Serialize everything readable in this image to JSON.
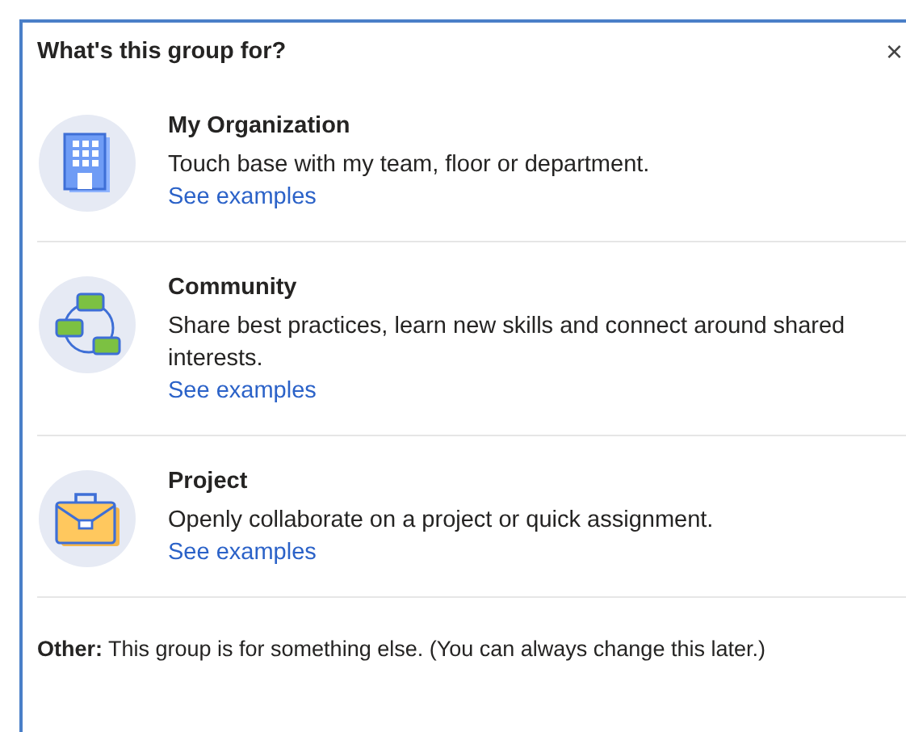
{
  "dialog": {
    "title": "What's this group for?",
    "close": "×"
  },
  "options": [
    {
      "kind": "building",
      "title": "My Organization",
      "description": "Touch base with my team, floor or department.",
      "link": "See examples"
    },
    {
      "kind": "network",
      "title": "Community",
      "description": "Share best practices, learn new skills and connect around shared interests.",
      "link": "See examples"
    },
    {
      "kind": "briefcase",
      "title": "Project",
      "description": "Openly collaborate on a project or quick assignment.",
      "link": "See examples"
    }
  ],
  "other": "**Other:** This group is for something else. (You can always change this later.)"
}
